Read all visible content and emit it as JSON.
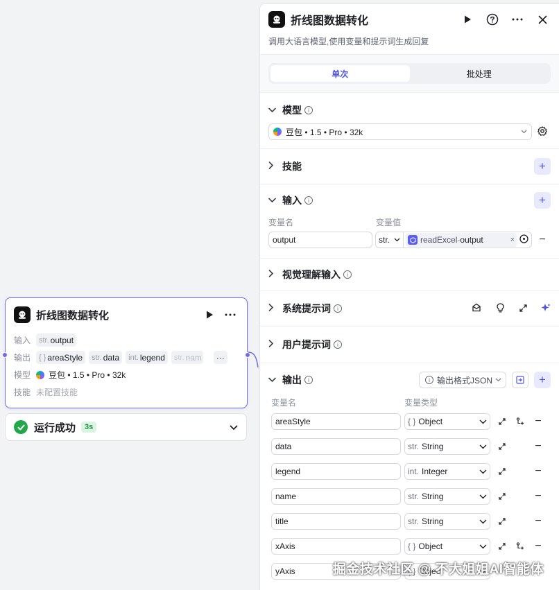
{
  "node": {
    "title": "折线图数据转化",
    "input_key": "输入",
    "input_tags": [
      {
        "type": "str.",
        "name": "output"
      }
    ],
    "output_key": "输出",
    "output_tags": [
      {
        "type": "{ }",
        "name": "areaStyle"
      },
      {
        "type": "str.",
        "name": "data"
      },
      {
        "type": "int.",
        "name": "legend"
      },
      {
        "type": "str.",
        "name": "nam"
      }
    ],
    "more_label": "···",
    "model_key": "模型",
    "model_value": "豆包 • 1.5 • Pro • 32k",
    "skill_key": "技能",
    "skill_value": "未配置技能"
  },
  "run": {
    "label": "运行成功",
    "duration": "3s"
  },
  "panel": {
    "title": "折线图数据转化",
    "description": "调用大语言模型,使用变量和提示词生成回复",
    "tabs": [
      {
        "label": "单次",
        "active": true
      },
      {
        "label": "批处理",
        "active": false
      }
    ],
    "model": {
      "label": "模型",
      "value": "豆包 • 1.5 • Pro • 32k"
    },
    "skills": {
      "label": "技能"
    },
    "input": {
      "label": "输入",
      "col_name": "变量名",
      "col_value": "变量值",
      "var_name": "output",
      "var_type": "str.",
      "ref_node": "readExcel",
      "ref_sep": " - ",
      "ref_field": "output"
    },
    "vision": {
      "label": "视觉理解输入"
    },
    "system_prompt": {
      "label": "系统提示词"
    },
    "user_prompt": {
      "label": "用户提示词"
    },
    "output": {
      "label": "输出",
      "format_label": "输出格式JSON",
      "col_name": "变量名",
      "col_type": "变量类型",
      "rows": [
        {
          "name": "areaStyle",
          "type_prefix": "{ }",
          "type": "Object",
          "expand": true,
          "child": true
        },
        {
          "name": "data",
          "type_prefix": "str.",
          "type": "String",
          "expand": true,
          "child": false
        },
        {
          "name": "legend",
          "type_prefix": "int.",
          "type": "Integer",
          "expand": true,
          "child": false
        },
        {
          "name": "name",
          "type_prefix": "str.",
          "type": "String",
          "expand": true,
          "child": false
        },
        {
          "name": "title",
          "type_prefix": "str.",
          "type": "String",
          "expand": true,
          "child": false
        },
        {
          "name": "xAxis",
          "type_prefix": "{ }",
          "type": "Object",
          "expand": true,
          "child": true
        },
        {
          "name": "yAxis",
          "type_prefix": "{ }",
          "type": "Object",
          "expand": false,
          "child": false
        }
      ]
    }
  },
  "watermark": "掘金技术社区 @ 不大姐姐AI智能体",
  "colors": {
    "accent": "#4d53e8",
    "node_border": "#6f6bea",
    "success": "#22a84a"
  }
}
